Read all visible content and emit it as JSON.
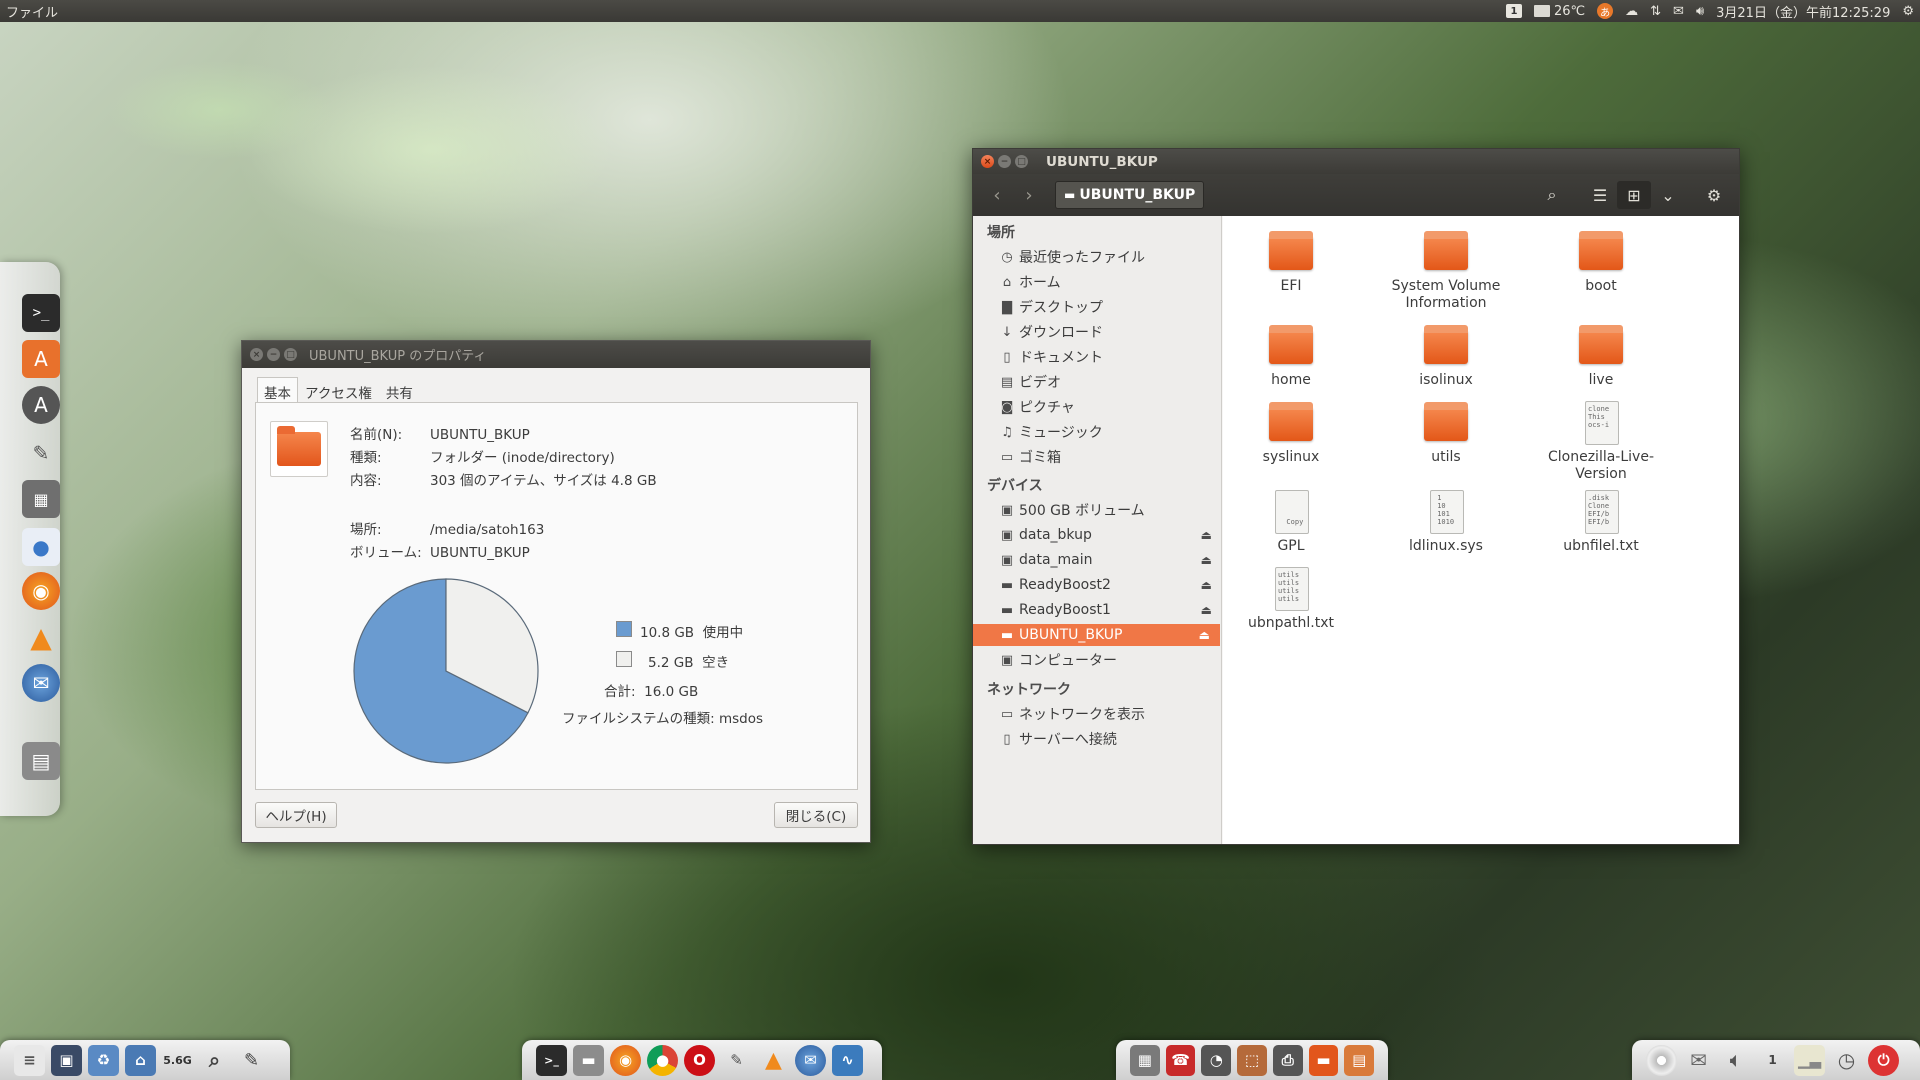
{
  "top_panel": {
    "app_menu": "ファイル",
    "temperature": "26℃",
    "datetime": "3月21日（金）午前12:25:29",
    "keyboard_indicator": "1"
  },
  "properties_dialog": {
    "title": "UBUNTU_BKUP のプロパティ",
    "tabs": [
      "基本",
      "アクセス権",
      "共有"
    ],
    "name_label": "名前(N):",
    "name_value": "UBUNTU_BKUP",
    "type_label": "種類:",
    "type_value": "フォルダー (inode/directory)",
    "contents_label": "内容:",
    "contents_value": "303 個のアイテム、サイズは 4.8 GB",
    "location_label": "場所:",
    "location_value": "/media/satoh163",
    "volume_label": "ボリューム:",
    "volume_value": "UBUNTU_BKUP",
    "used_size": "10.8 GB",
    "used_label": "使用中",
    "free_size": "5.2 GB",
    "free_label": "空き",
    "total_label": "合計:",
    "total_value": "16.0 GB",
    "fs_label": "ファイルシステムの種類:",
    "fs_value": "msdos",
    "help_button": "ヘルプ(H)",
    "close_button": "閉じる(C)",
    "used_color": "#6a9bd0",
    "free_color": "#f0f0ee"
  },
  "chart_data": {
    "type": "pie",
    "categories": [
      "使用中",
      "空き"
    ],
    "values": [
      10.8,
      5.2
    ]
  },
  "file_manager": {
    "title": "UBUNTU_BKUP",
    "path_button": "UBUNTU_BKUP",
    "sidebar": {
      "places_header": "場所",
      "places": [
        {
          "label": "最近使ったファイル",
          "icon": "clock-icon"
        },
        {
          "label": "ホーム",
          "icon": "home-icon"
        },
        {
          "label": "デスクトップ",
          "icon": "folder-icon"
        },
        {
          "label": "ダウンロード",
          "icon": "download-icon"
        },
        {
          "label": "ドキュメント",
          "icon": "document-icon"
        },
        {
          "label": "ビデオ",
          "icon": "film-icon"
        },
        {
          "label": "ピクチャ",
          "icon": "camera-icon"
        },
        {
          "label": "ミュージック",
          "icon": "music-icon"
        },
        {
          "label": "ゴミ箱",
          "icon": "trash-icon"
        }
      ],
      "devices_header": "デバイス",
      "devices": [
        {
          "label": "500 GB ボリューム",
          "icon": "drive-icon"
        },
        {
          "label": "data_bkup",
          "icon": "drive-icon"
        },
        {
          "label": "data_main",
          "icon": "drive-icon"
        },
        {
          "label": "ReadyBoost2",
          "icon": "usb-drive-icon"
        },
        {
          "label": "ReadyBoost1",
          "icon": "usb-drive-icon"
        },
        {
          "label": "UBUNTU_BKUP",
          "icon": "usb-drive-icon"
        },
        {
          "label": "コンピューター",
          "icon": "drive-icon"
        }
      ],
      "network_header": "ネットワーク",
      "network": [
        {
          "label": "ネットワークを表示",
          "icon": "network-icon"
        },
        {
          "label": "サーバーへ接続",
          "icon": "server-icon"
        }
      ]
    },
    "items": [
      {
        "name": "EFI",
        "kind": "folder"
      },
      {
        "name": "System Volume Information",
        "kind": "folder"
      },
      {
        "name": "boot",
        "kind": "folder"
      },
      {
        "name": "home",
        "kind": "folder"
      },
      {
        "name": "isolinux",
        "kind": "folder"
      },
      {
        "name": "live",
        "kind": "folder"
      },
      {
        "name": "syslinux",
        "kind": "folder"
      },
      {
        "name": "utils",
        "kind": "folder"
      },
      {
        "name": "Clonezilla-Live-Version",
        "kind": "text"
      },
      {
        "name": "GPL",
        "kind": "text"
      },
      {
        "name": "ldlinux.sys",
        "kind": "binary"
      },
      {
        "name": "ubnfilel.txt",
        "kind": "text"
      },
      {
        "name": "ubnpathl.txt",
        "kind": "text"
      }
    ]
  },
  "dock": {
    "disk_label": "5.6G"
  },
  "colors": {
    "accent": "#f07746",
    "panel": "#3c3b37"
  }
}
